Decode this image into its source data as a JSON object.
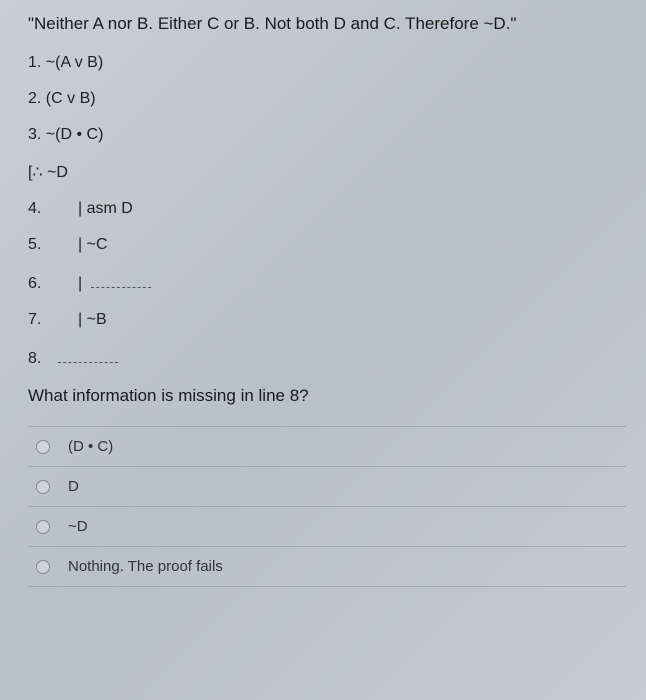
{
  "problem": "\"Neither A nor B. Either C or B.  Not both D and C. Therefore ~D.\"",
  "premises": [
    "1. ~(A v B)",
    "2. (C v B)",
    "3. ~(D • C)",
    "[∴ ~D"
  ],
  "proof_lines": [
    {
      "num": "4.",
      "content": "| asm D",
      "blank": false
    },
    {
      "num": "5.",
      "content": "| ~C",
      "blank": false
    },
    {
      "num": "6.",
      "content": "| ",
      "blank": true
    },
    {
      "num": "7.",
      "content": "| ~B",
      "blank": false
    },
    {
      "num": "8.",
      "content": "",
      "blank": true
    }
  ],
  "question": "What information is missing in line 8?",
  "options": [
    "(D • C)",
    "D",
    "~D",
    "Nothing. The proof fails"
  ]
}
